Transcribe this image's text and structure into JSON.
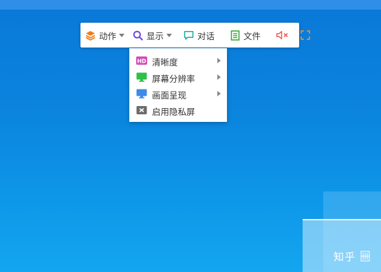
{
  "toolbar": {
    "action": {
      "label": "动作",
      "icon": "layers-icon"
    },
    "display": {
      "label": "显示",
      "icon": "search-icon"
    },
    "chat": {
      "label": "对话",
      "icon": "chat-bubble-icon"
    },
    "file": {
      "label": "文件",
      "icon": "document-icon"
    },
    "mute": {
      "icon": "speaker-muted-icon"
    },
    "fullscreen": {
      "icon": "fullscreen-icon"
    }
  },
  "display_menu": {
    "items": [
      {
        "label": "清晰度",
        "icon": "hd-icon",
        "has_submenu": true
      },
      {
        "label": "屏幕分辨率",
        "icon": "monitor-icon",
        "has_submenu": true
      },
      {
        "label": "画面呈现",
        "icon": "screen-icon",
        "has_submenu": true
      },
      {
        "label": "启用隐私屏",
        "icon": "privacy-screen-icon",
        "has_submenu": false
      }
    ]
  },
  "watermark": {
    "text": "知乎"
  },
  "colors": {
    "desktop_blue": "#0b86df",
    "action_orange": "#f07c1a",
    "display_purple": "#6f4bd8",
    "chat_teal": "#1aa8a8",
    "file_green": "#3aaa3a",
    "mute_red": "#e8564a",
    "fullscreen_orange": "#f0862a",
    "hd_magenta": "#d24bb8",
    "monitor_green": "#2fbf4a",
    "screen_blue": "#3d8ae8",
    "privacy_gray": "#6b6b6b"
  }
}
